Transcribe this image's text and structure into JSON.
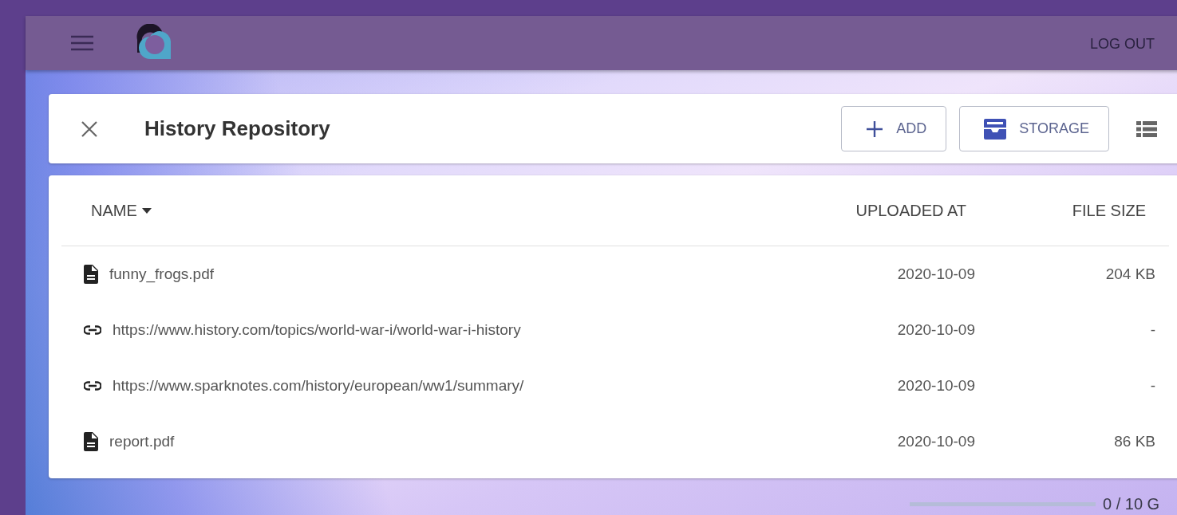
{
  "app_bar": {
    "logout": "LOG OUT"
  },
  "header": {
    "title": "History Repository",
    "buttons": [
      {
        "label": "ADD",
        "kind": "add"
      },
      {
        "label": "STORAGE",
        "kind": "storage"
      }
    ]
  },
  "table": {
    "columns": [
      {
        "label": "NAME",
        "sorted": true
      },
      {
        "label": "UPLOADED AT",
        "sorted": false
      },
      {
        "label": "FILE SIZE",
        "sorted": false
      }
    ],
    "rows": [
      {
        "kind": "file",
        "name": "funny_frogs.pdf",
        "uploaded_at": "2020-10-09",
        "file_size": "204 KB"
      },
      {
        "kind": "link",
        "name": "https://www.history.com/topics/world-war-i/world-war-i-history",
        "uploaded_at": "2020-10-09",
        "file_size": "-"
      },
      {
        "kind": "link",
        "name": "https://www.sparknotes.com/history/european/ww1/summary/",
        "uploaded_at": "2020-10-09",
        "file_size": "-"
      },
      {
        "kind": "file",
        "name": "report.pdf",
        "uploaded_at": "2020-10-09",
        "file_size": "86 KB"
      }
    ]
  },
  "storage": {
    "level": 0,
    "reading": "0 / 10 G"
  }
}
